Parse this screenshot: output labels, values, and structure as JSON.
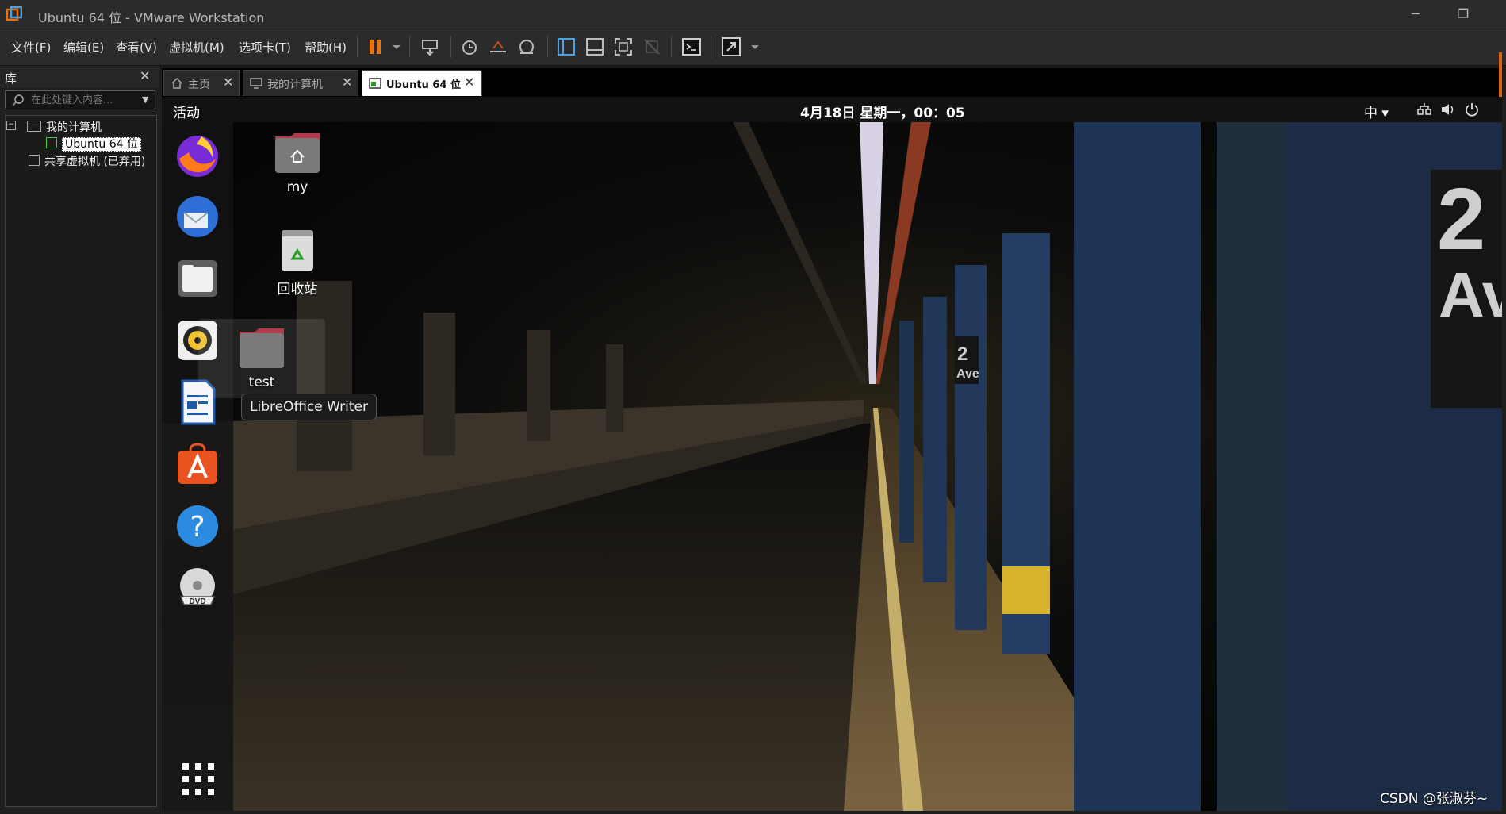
{
  "window": {
    "title": "Ubuntu 64 位 - VMware Workstation",
    "minimize_icon": "minimize-icon",
    "restore_icon": "restore-icon",
    "accent": "#e8730e"
  },
  "menu": {
    "items": [
      "文件(F)",
      "编辑(E)",
      "查看(V)",
      "虚拟机(M)",
      "选项卡(T)",
      "帮助(H)"
    ]
  },
  "library": {
    "title": "库",
    "search_placeholder": "在此处键入内容...",
    "tree": {
      "my_computer": "我的计算机",
      "selected_vm": "Ubuntu 64 位",
      "shared": "共享虚拟机 (已弃用)"
    }
  },
  "tabs": [
    {
      "label": "主页",
      "icon": "home-icon"
    },
    {
      "label": "我的计算机",
      "icon": "computer-icon"
    },
    {
      "label": "Ubuntu 64 位",
      "icon": "vm-icon",
      "active": true
    }
  ],
  "guest": {
    "activities": "活动",
    "clock": "4月18日 星期一，00：05",
    "input_method": "中 ▾",
    "dock_apps": [
      "Firefox",
      "Thunderbird",
      "Files",
      "Rhythmbox",
      "LibreOffice Writer",
      "Ubuntu Software",
      "Help",
      "DVD"
    ],
    "tooltip": "LibreOffice Writer",
    "desktop_icons": [
      {
        "label": "my"
      },
      {
        "label": "回收站"
      },
      {
        "label": "test"
      }
    ]
  },
  "watermark": "CSDN @张淑芬~"
}
